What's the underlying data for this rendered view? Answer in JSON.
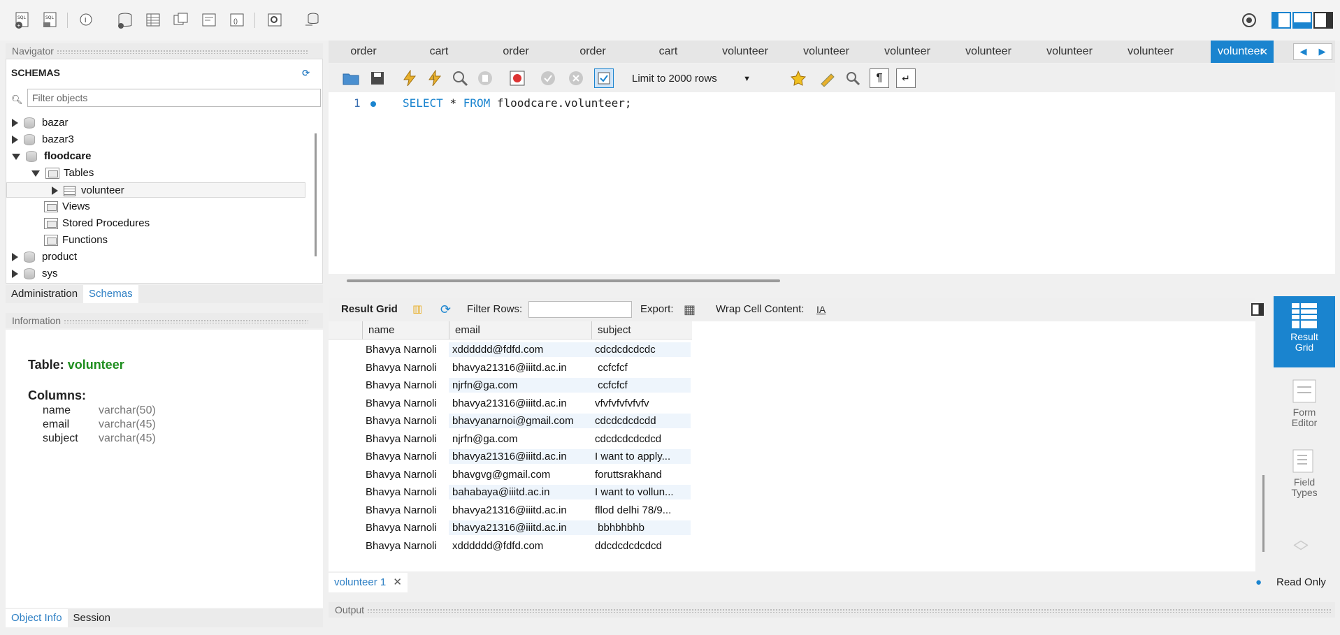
{
  "navigator": {
    "title": "Navigator",
    "schemas_label": "SCHEMAS",
    "filter_placeholder": "Filter objects",
    "tree": [
      {
        "label": "bazar",
        "bold": false
      },
      {
        "label": "bazar3",
        "bold": false
      },
      {
        "label": "floodcare",
        "bold": true
      },
      {
        "label": "Tables"
      },
      {
        "label": "volunteer"
      },
      {
        "label": "Views"
      },
      {
        "label": "Stored Procedures"
      },
      {
        "label": "Functions"
      },
      {
        "label": "product"
      },
      {
        "label": "sys"
      }
    ],
    "tabs": [
      "Administration",
      "Schemas"
    ]
  },
  "information": {
    "title": "Information",
    "table_label": "Table:",
    "table_name": "volunteer",
    "columns_label": "Columns:",
    "columns": [
      {
        "name": "name",
        "type": "varchar(50)"
      },
      {
        "name": "email",
        "type": "varchar(45)"
      },
      {
        "name": "subject",
        "type": "varchar(45)"
      }
    ],
    "tabs": [
      "Object Info",
      "Session"
    ]
  },
  "editor_tabs": [
    "order",
    "cart",
    "order",
    "order",
    "cart",
    "volunteer",
    "volunteer",
    "volunteer",
    "volunteer",
    "volunteer",
    "volunteer",
    "volunteer"
  ],
  "editor_toolbar": {
    "limit_label": "Limit to 2000 rows"
  },
  "sql": {
    "line_number": "1",
    "kw_select": "SELECT",
    "star": "*",
    "kw_from": "FROM",
    "target": "floodcare.volunteer;"
  },
  "result_toolbar": {
    "result_grid": "Result Grid",
    "filter_rows": "Filter Rows:",
    "export": "Export:",
    "wrap": "Wrap Cell Content:"
  },
  "grid": {
    "columns": [
      "name",
      "email",
      "subject"
    ],
    "rows": [
      [
        "Bhavya Narnoli",
        "xdddddd@fdfd.com",
        "cdcdcdcdcdc"
      ],
      [
        "Bhavya Narnoli",
        "bhavya21316@iiitd.ac.in",
        " ccfcfcf"
      ],
      [
        "Bhavya Narnoli",
        "njrfn@ga.com",
        " ccfcfcf"
      ],
      [
        "Bhavya Narnoli",
        "bhavya21316@iiitd.ac.in",
        "vfvfvfvfvfvfv"
      ],
      [
        "Bhavya Narnoli",
        "bhavyanarnoi@gmail.com",
        "cdcdcdcdcdd"
      ],
      [
        "Bhavya Narnoli",
        "njrfn@ga.com",
        "cdcdcdcdcdcd"
      ],
      [
        "Bhavya Narnoli",
        "bhavya21316@iiitd.ac.in",
        "I want to apply..."
      ],
      [
        "Bhavya Narnoli",
        "bhavgvg@gmail.com",
        "foruttsrakhand"
      ],
      [
        "Bhavya Narnoli",
        "bahabaya@iiitd.ac.in",
        "I want to vollun..."
      ],
      [
        "Bhavya Narnoli",
        "bhavya21316@iiitd.ac.in",
        "fllod delhi 78/9..."
      ],
      [
        "Bhavya Narnoli",
        "bhavya21316@iiitd.ac.in",
        " bbhbhbhb"
      ],
      [
        "Bhavya Narnoli",
        "xdddddd@fdfd.com",
        "ddcdcdcdcdcd"
      ]
    ]
  },
  "result_tab": "volunteer 1",
  "read_only": "Read Only",
  "output_title": "Output",
  "side_panel": [
    {
      "label": "Result\nGrid"
    },
    {
      "label": "Form\nEditor"
    },
    {
      "label": "Field\nTypes"
    }
  ],
  "colors": {
    "accent": "#1a84cf",
    "green": "#1e8e1e"
  }
}
